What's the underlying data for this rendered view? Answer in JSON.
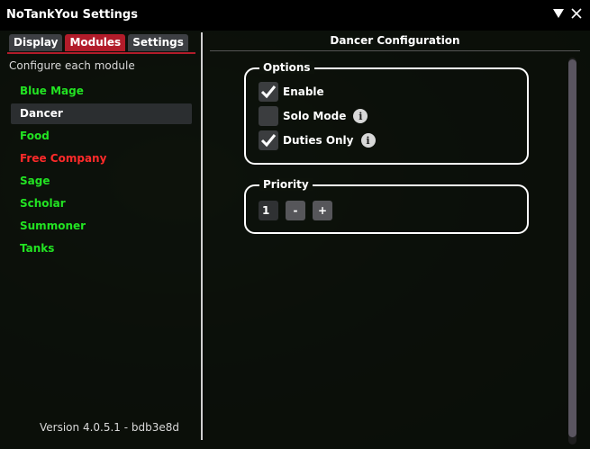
{
  "window": {
    "title": "NoTankYou Settings",
    "collapse_icon": "triangle-down-icon",
    "close_icon": "close-icon"
  },
  "tabs": [
    {
      "label": "Display",
      "active": false
    },
    {
      "label": "Modules",
      "active": true
    },
    {
      "label": "Settings",
      "active": false
    }
  ],
  "sidebar": {
    "caption": "Configure each module",
    "items": [
      {
        "label": "Blue Mage",
        "color": "#22e322",
        "selected": false
      },
      {
        "label": "Dancer",
        "color": "#ffffff",
        "selected": true
      },
      {
        "label": "Food",
        "color": "#22e322",
        "selected": false
      },
      {
        "label": "Free Company",
        "color": "#ff2a2a",
        "selected": false
      },
      {
        "label": "Sage",
        "color": "#22e322",
        "selected": false
      },
      {
        "label": "Scholar",
        "color": "#22e322",
        "selected": false
      },
      {
        "label": "Summoner",
        "color": "#22e322",
        "selected": false
      },
      {
        "label": "Tanks",
        "color": "#22e322",
        "selected": false
      }
    ],
    "version": "Version 4.0.5.1 - bdb3e8d"
  },
  "main": {
    "header": "Dancer Configuration",
    "options": {
      "title": "Options",
      "enable": {
        "label": "Enable",
        "checked": true
      },
      "solo_mode": {
        "label": "Solo Mode",
        "checked": false,
        "info": "i"
      },
      "duties_only": {
        "label": "Duties Only",
        "checked": true,
        "info": "i"
      }
    },
    "priority": {
      "title": "Priority",
      "value": "1",
      "minus_label": "-",
      "plus_label": "+"
    }
  },
  "colors": {
    "accent": "#b21c2a",
    "enabled_module": "#22e322",
    "disabled_module": "#ff2a2a"
  }
}
